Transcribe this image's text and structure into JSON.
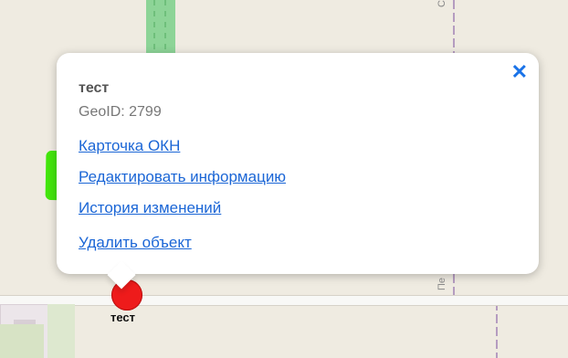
{
  "map": {
    "street_label_top": "Стах",
    "street_label_bottom": "Пе"
  },
  "marker": {
    "label": "тест"
  },
  "popup": {
    "title": "тест",
    "geoid": "GeoID: 2799",
    "close_symbol": "✕",
    "links": [
      "Карточка ОКН",
      "Редактировать информацию",
      "История изменений",
      "Удалить объект"
    ]
  },
  "colors": {
    "accent": "#1b66d6",
    "highlight": "#39e600",
    "marker": "#ee1b1b"
  }
}
